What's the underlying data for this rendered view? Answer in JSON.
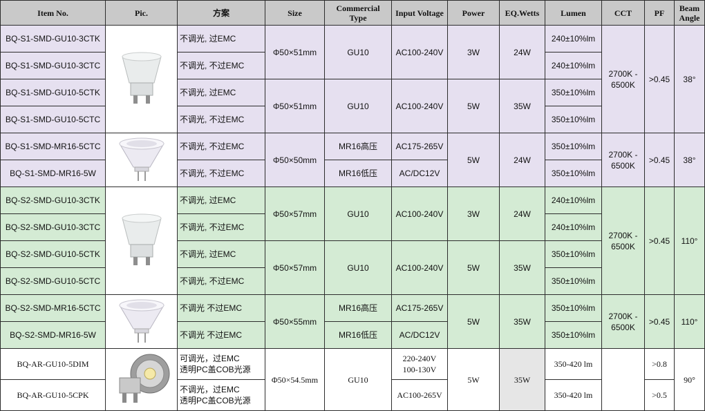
{
  "headers": {
    "item_no": "Item No.",
    "pic": "Pic.",
    "scheme": "方案",
    "size": "Size",
    "commercial_type": "Commercial\nType",
    "input_voltage": "Input Voltage",
    "power": "Power",
    "eq_wetts": "EQ.Wetts",
    "lumen": "Lumen",
    "cct": "CCT",
    "pf": "PF",
    "beam_angle": "Beam\nAngle"
  },
  "items": [
    {
      "item_no": "BQ-S1-SMD-GU10-3CTK",
      "scheme": "不调光, 过EMC",
      "lumen": "240±10%lm"
    },
    {
      "item_no": "BQ-S1-SMD-GU10-3CTC",
      "scheme": "不调光, 不过EMC",
      "lumen": "240±10%lm"
    },
    {
      "item_no": "BQ-S1-SMD-GU10-5CTK",
      "scheme": "不调光, 过EMC",
      "lumen": "350±10%lm"
    },
    {
      "item_no": "BQ-S1-SMD-GU10-5CTC",
      "scheme": "不调光, 不过EMC",
      "lumen": "350±10%lm"
    },
    {
      "item_no": "BQ-S1-SMD-MR16-5CTC",
      "scheme": "不调光, 不过EMC",
      "lumen": "350±10%lm"
    },
    {
      "item_no": "BQ-S1-SMD-MR16-5W",
      "scheme": "不调光, 不过EMC",
      "lumen": "350±10%lm"
    },
    {
      "item_no": "BQ-S2-SMD-GU10-3CTK",
      "scheme": "不调光, 过EMC",
      "lumen": "240±10%lm"
    },
    {
      "item_no": "BQ-S2-SMD-GU10-3CTC",
      "scheme": "不调光, 不过EMC",
      "lumen": "240±10%lm"
    },
    {
      "item_no": "BQ-S2-SMD-GU10-5CTK",
      "scheme": "不调光, 过EMC",
      "lumen": "350±10%lm"
    },
    {
      "item_no": "BQ-S2-SMD-GU10-5CTC",
      "scheme": "不调光, 不过EMC",
      "lumen": "350±10%lm"
    },
    {
      "item_no": "BQ-S2-SMD-MR16-5CTC",
      "scheme": "不调光  不过EMC",
      "lumen": "350±10%lm"
    },
    {
      "item_no": "BQ-S2-SMD-MR16-5W",
      "scheme": "不调光  不过EMC",
      "lumen": "350±10%lm"
    },
    {
      "item_no": "BQ-AR-GU10-5DIM",
      "scheme": "可调光，过EMC\n透明PC盖COB光源",
      "lumen": "350-420 lm"
    },
    {
      "item_no": "BQ-AR-GU10-5CPK",
      "scheme": "不调光，过EMC\n透明PC盖COB光源",
      "lumen": "350-420 lm"
    }
  ],
  "merged": {
    "size_s1_gu10": "Φ50×51mm",
    "size_s1_mr16": "Φ50×50mm",
    "size_s2_gu10": "Φ50×57mm",
    "size_s2_mr16": "Φ50×55mm",
    "size_ar": "Φ50×54.5mm",
    "type_gu10": "GU10",
    "type_mr16_hv": "MR16高压",
    "type_mr16_lv": "MR16低压",
    "volt_ac100_240": "AC100-240V",
    "volt_ac175_265": "AC175-265V",
    "volt_acdc12": "AC/DC12V",
    "volt_ar_1": "220-240V\n100-130V",
    "volt_ar_2": "AC100-265V",
    "power_3w": "3W",
    "power_5w": "5W",
    "eq_24w": "24W",
    "eq_35w": "35W",
    "cct": "2700K -\n6500K",
    "pf_045": ">0.45",
    "pf_08": ">0.8",
    "pf_05": ">0.5",
    "beam_38": "38°",
    "beam_110": "110°",
    "beam_90": "90°"
  },
  "colors": {
    "header_bg": "#c9c9c9",
    "s1_bg": "#e6e0f0",
    "s2_bg": "#d4ebd4",
    "ar_bg": "#ffffff",
    "ar_eq_bg": "#e6e6e6",
    "border": "#2c2c2c"
  },
  "icons": [
    "gu10-bulb-icon",
    "mr16-bulb-icon",
    "gu10-bulb-icon",
    "mr16-bulb-icon",
    "cob-gu10-bulb-icon"
  ]
}
